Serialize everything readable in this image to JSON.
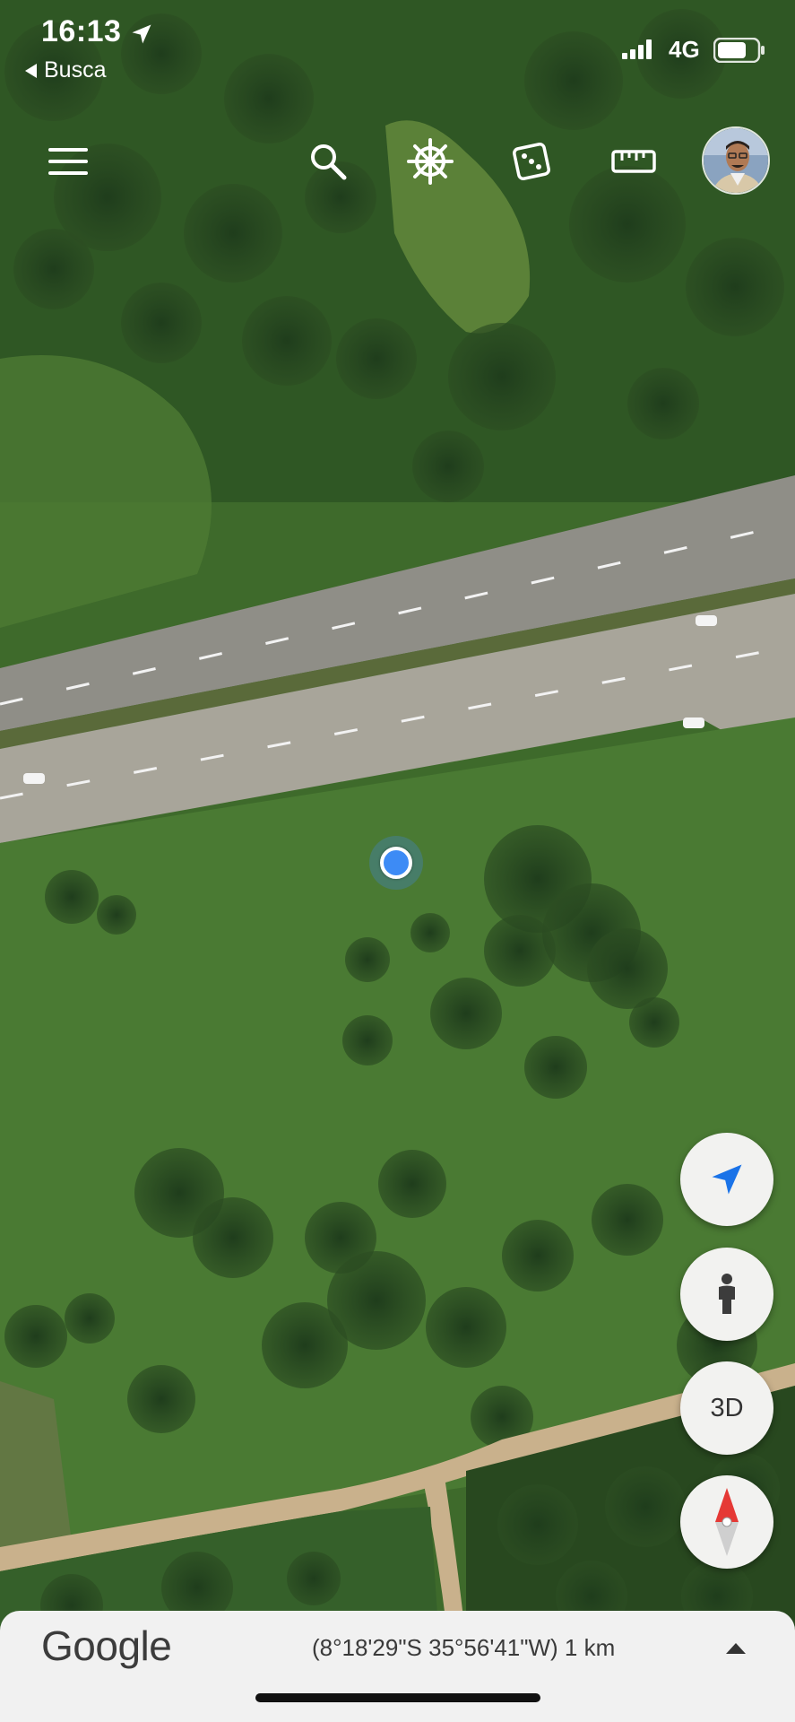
{
  "status_bar": {
    "time": "16:13",
    "back_label": "Busca",
    "network": "4G"
  },
  "toolbar": {
    "icons": [
      "menu-icon",
      "search-icon",
      "voyager-wheel-icon",
      "dice-icon",
      "ruler-icon",
      "avatar"
    ]
  },
  "map": {
    "type": "satellite",
    "features": [
      "highway",
      "dirt-road",
      "vegetation"
    ],
    "colors": {
      "vegetation": "#3f6a2c",
      "road": "#8d8d86",
      "dirt": "#c9b18c",
      "location": "#3d8bf5"
    }
  },
  "controls": {
    "three_d_label": "3D",
    "icons": [
      "navigate-icon",
      "pegman-icon",
      "compass-icon"
    ]
  },
  "bottom_bar": {
    "logo": "Google",
    "coordinates": "(8°18'29\"S 35°56'41\"W) 1 km"
  }
}
